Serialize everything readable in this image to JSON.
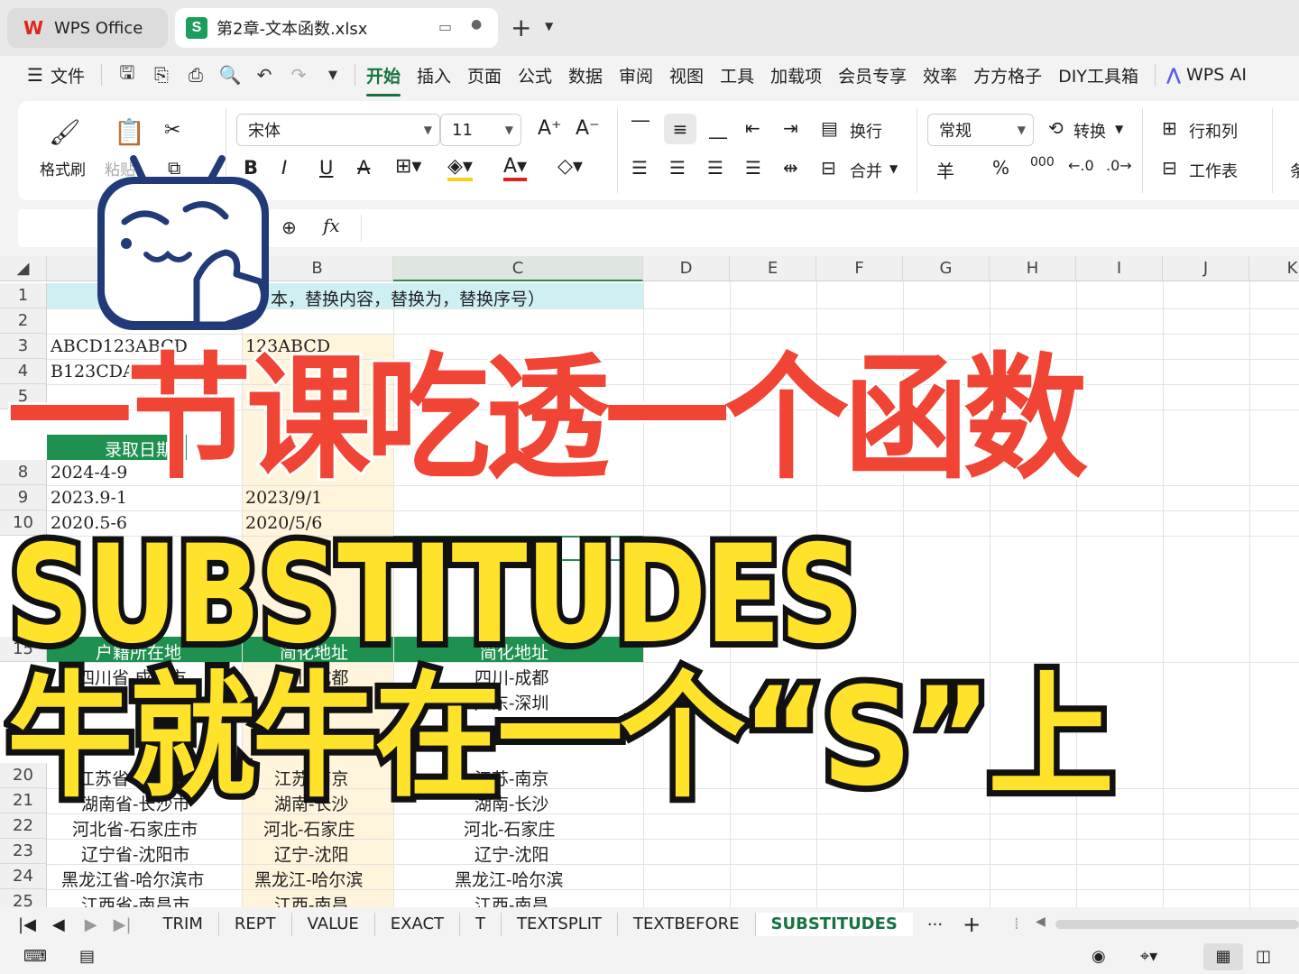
{
  "titlebar": {
    "wps_tab": "WPS Office",
    "file_tab": "第2章-文本函数.xlsx"
  },
  "menu": {
    "file": "文件",
    "items": [
      "开始",
      "插入",
      "页面",
      "公式",
      "数据",
      "审阅",
      "视图",
      "工具",
      "加载项",
      "会员专享",
      "效率",
      "方方格子",
      "DIY工具箱"
    ],
    "ai": "WPS AI"
  },
  "ribbon": {
    "format_painter": "格式刷",
    "paste": "粘贴",
    "font_name": "宋体",
    "font_size": "11",
    "wrap": "换行",
    "merge": "合并",
    "number_format": "常规",
    "convert": "转换",
    "rows_cols": "行和列",
    "worksheet": "工作表",
    "more": "条",
    "currency": "羊",
    "percent": "%",
    "thousands": "000"
  },
  "formula_bar": {
    "fx": "fx"
  },
  "columns": [
    "B",
    "C",
    "D",
    "E",
    "F",
    "G",
    "H",
    "I",
    "J",
    "K"
  ],
  "rows": [
    "1",
    "2",
    "3",
    "4",
    "5",
    "8",
    "9",
    "10",
    "15",
    "20",
    "21",
    "22",
    "23",
    "24",
    "25"
  ],
  "cells": {
    "r1_title": "本，替换内容，替换为，替换序号）",
    "a3": "ABCD123ABCD",
    "b3": "123ABCD",
    "a4": "B123CDACD",
    "a7_header": "录取日期",
    "a8": "2024-4-9",
    "a9": "2023.9-1",
    "b9": "2023/9/1",
    "a10": "2020.5-6",
    "b10": "2020/5/6",
    "a15": "户籍所在地",
    "b15": "简化地址",
    "c15": "简化地址",
    "a16": "四川省-成都市",
    "b16": "四川-成都",
    "c16": "四川-成都",
    "c17": "广东-深圳",
    "a20": "江苏省-南京市",
    "b20": "江苏-南京",
    "c20": "江苏-南京",
    "a21": "湖南省-长沙市",
    "b21": "湖南-长沙",
    "c21": "湖南-长沙",
    "a22": "河北省-石家庄市",
    "b22": "河北-石家庄",
    "c22": "河北-石家庄",
    "a23": "辽宁省-沈阳市",
    "b23": "辽宁-沈阳",
    "c23": "辽宁-沈阳",
    "a24": "黑龙江省-哈尔滨市",
    "b24": "黑龙江-哈尔滨",
    "c24": "黑龙江-哈尔滨",
    "a25": "江西省-南昌市",
    "b25": "江西-南昌",
    "c25": "江西-南昌"
  },
  "sheet_tabs": [
    "TRIM",
    "REPT",
    "VALUE",
    "EXACT",
    "T",
    "TEXTSPLIT",
    "TEXTBEFORE",
    "SUBSTITUDES"
  ],
  "active_sheet": "SUBSTITUDES",
  "overlay": {
    "line1": "一节课吃透一个函数",
    "line2": "SUBSTITUDES",
    "line3": "牛就牛在一个“S”上"
  },
  "colors": {
    "accent": "#15733f",
    "header_green": "#1e9150",
    "overlay_red": "#f04434",
    "overlay_yellow": "#ffe32a"
  }
}
